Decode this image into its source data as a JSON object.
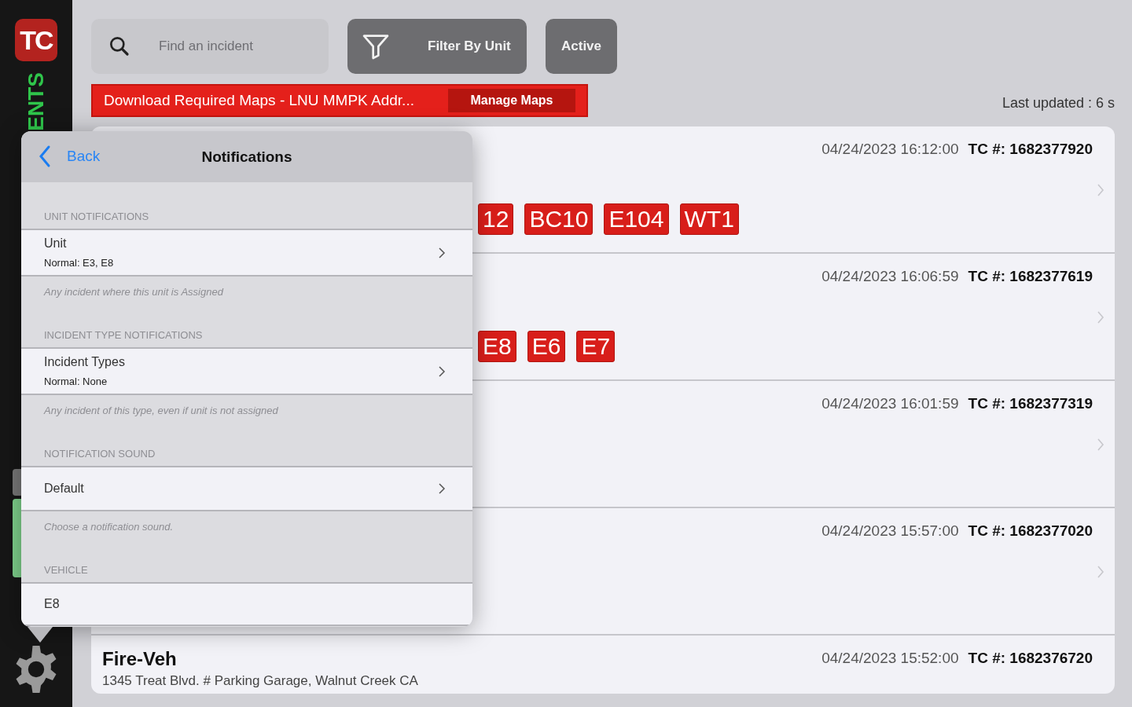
{
  "sidebar": {
    "logo": "TC",
    "section_label": "ENTS"
  },
  "toolbar": {
    "search": {
      "placeholder": "Find an incident"
    },
    "filter_button": "Filter By Unit",
    "status_button": "Active"
  },
  "banner": {
    "text": "Download Required Maps - LNU MMPK Addr...",
    "button": "Manage Maps"
  },
  "last_updated": "Last updated : 6 s",
  "incidents": [
    {
      "date": "04/24/2023 16:12:00",
      "tc_label": "TC #:",
      "tc_number": "1682377920",
      "chevron": true,
      "units": [
        "12",
        "BC10",
        "E104",
        "WT1"
      ]
    },
    {
      "date": "04/24/2023 16:06:59",
      "tc_label": "TC #:",
      "tc_number": "1682377619",
      "chevron": true,
      "units": [
        "E8",
        "E6",
        "E7"
      ]
    },
    {
      "date": "04/24/2023 16:01:59",
      "tc_label": "TC #:",
      "tc_number": "1682377319",
      "chevron": true
    },
    {
      "date": "04/24/2023 15:57:00",
      "tc_label": "TC #:",
      "tc_number": "1682377020",
      "chevron": true
    },
    {
      "title": "Fire-Veh",
      "address": "1345 Treat Blvd. # Parking Garage, Walnut Creek CA",
      "date": "04/24/2023 15:52:00",
      "tc_label": "TC #:",
      "tc_number": "1682376720",
      "chevron": false
    }
  ],
  "popover": {
    "back": "Back",
    "title": "Notifications",
    "sections": [
      {
        "header": "UNIT NOTIFICATIONS",
        "row": {
          "title": "Unit",
          "subtitle": "Normal: E3, E8",
          "chevron": true
        },
        "footer": "Any incident where this unit is Assigned"
      },
      {
        "header": "INCIDENT TYPE NOTIFICATIONS",
        "row": {
          "title": "Incident Types",
          "subtitle": "Normal: None",
          "chevron": true
        },
        "footer": "Any incident of this type, even if unit is not assigned"
      },
      {
        "header": "NOTIFICATION SOUND",
        "row": {
          "title": "Default",
          "chevron": true
        },
        "footer": "Choose a notification sound."
      },
      {
        "header": "VEHICLE",
        "row": {
          "title": "E8",
          "chevron": false
        }
      }
    ]
  }
}
